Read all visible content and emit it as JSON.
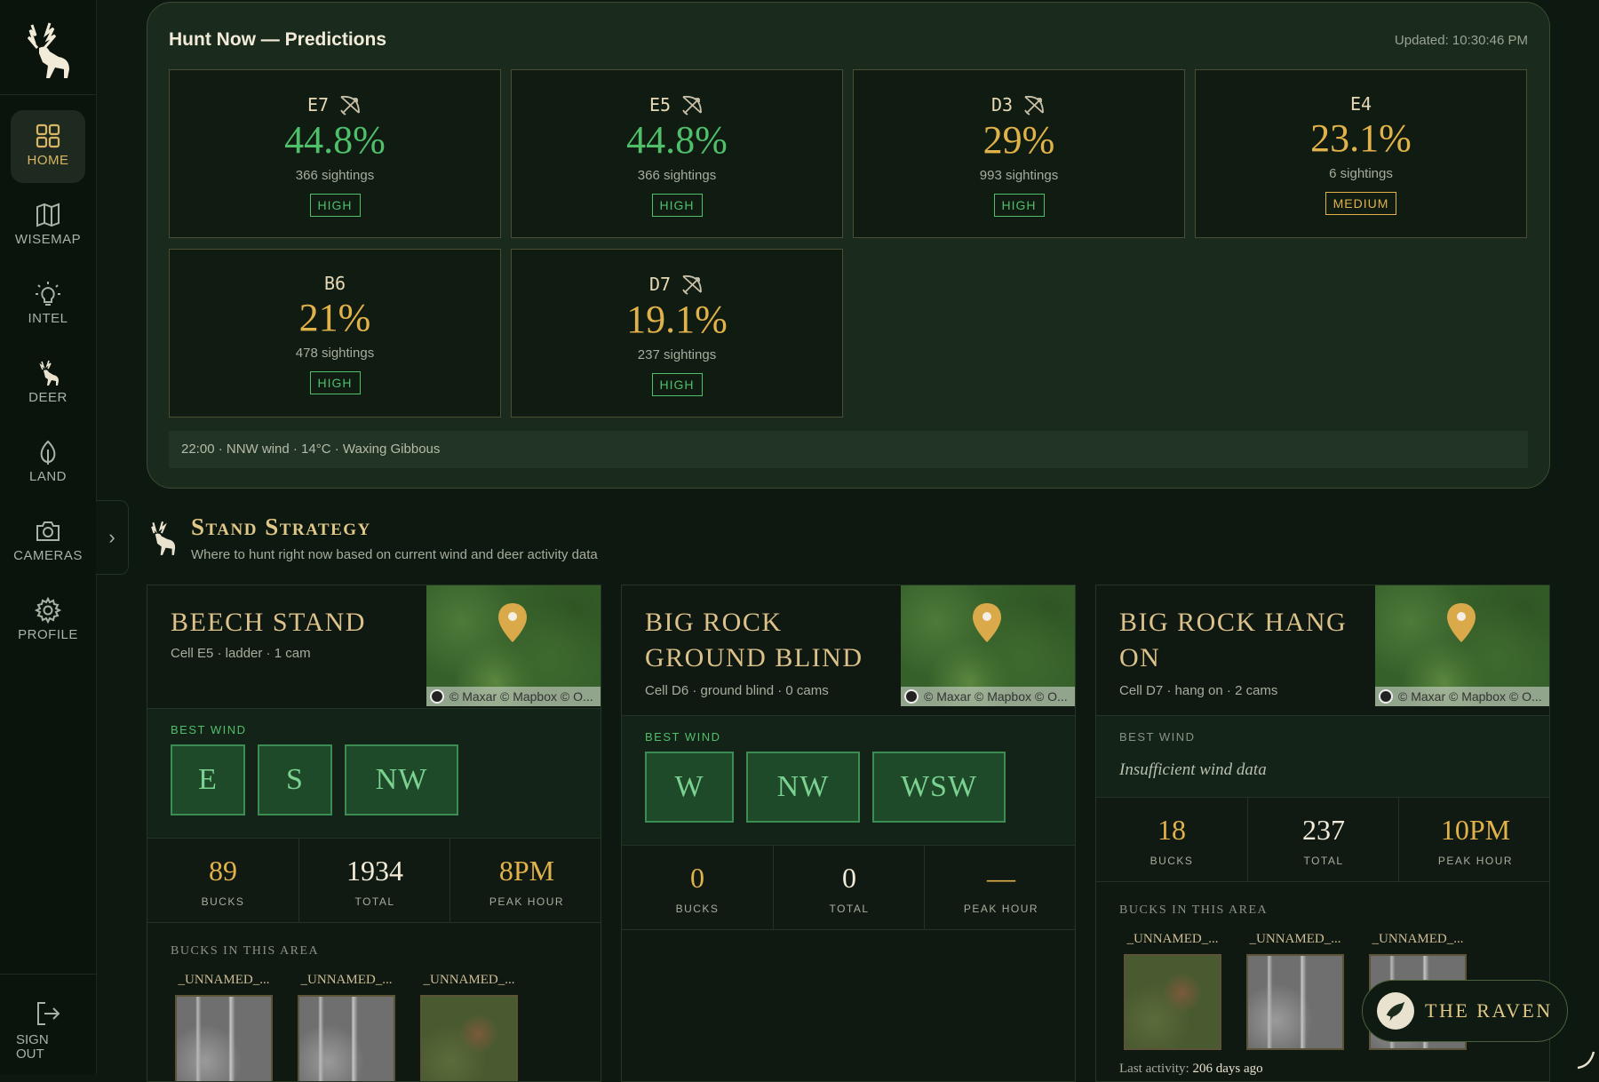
{
  "sidebar": {
    "items": [
      {
        "label": "HOME",
        "icon": "grid-icon",
        "active": true
      },
      {
        "label": "WISEMAP",
        "icon": "map-icon"
      },
      {
        "label": "INTEL",
        "icon": "lightbulb-icon"
      },
      {
        "label": "DEER",
        "icon": "deer-icon"
      },
      {
        "label": "LAND",
        "icon": "leaf-icon"
      },
      {
        "label": "CAMERAS",
        "icon": "camera-icon"
      },
      {
        "label": "PROFILE",
        "icon": "gear-icon"
      }
    ],
    "signout_label": "SIGN OUT"
  },
  "predictions": {
    "title": "Hunt Now — Predictions",
    "updated": "Updated: 10:30:46 PM",
    "cards": [
      {
        "cell": "E7",
        "pct": "44.8%",
        "sightings": "366 sightings",
        "level": "HIGH",
        "bow": true,
        "color": "green"
      },
      {
        "cell": "E5",
        "pct": "44.8%",
        "sightings": "366 sightings",
        "level": "HIGH",
        "bow": true,
        "color": "green"
      },
      {
        "cell": "D3",
        "pct": "29%",
        "sightings": "993 sightings",
        "level": "HIGH",
        "bow": true,
        "color": "gold"
      },
      {
        "cell": "E4",
        "pct": "23.1%",
        "sightings": "6 sightings",
        "level": "MEDIUM",
        "bow": false,
        "color": "gold"
      },
      {
        "cell": "B6",
        "pct": "21%",
        "sightings": "478 sightings",
        "level": "HIGH",
        "bow": false,
        "color": "gold"
      },
      {
        "cell": "D7",
        "pct": "19.1%",
        "sightings": "237 sightings",
        "level": "HIGH",
        "bow": true,
        "color": "gold"
      }
    ],
    "footer": "22:00 · NNW wind · 14°C · Waxing Gibbous"
  },
  "strategy": {
    "title": "Stand Strategy",
    "subtitle": "Where to hunt right now based on current wind and deer activity data",
    "map_attribution": "© Maxar © Mapbox © O...",
    "best_wind_label": "BEST WIND",
    "bucks_label": "BUCKS IN THIS AREA",
    "stats_labels": {
      "bucks": "BUCKS",
      "total": "TOTAL",
      "peak": "PEAK HOUR"
    },
    "stands": [
      {
        "name": "BEECH STAND",
        "meta": "Cell E5 · ladder · 1 cam",
        "winds": [
          "E",
          "S",
          "NW"
        ],
        "no_wind": "",
        "bucks": "89",
        "total": "1934",
        "peak": "8PM",
        "buck_names": [
          "_UNNAMED_...",
          "_UNNAMED_...",
          "_UNNAMED_..."
        ],
        "last": ""
      },
      {
        "name": "BIG ROCK GROUND BLIND",
        "meta": "Cell D6 · ground blind · 0 cams",
        "winds": [
          "W",
          "NW",
          "WSW"
        ],
        "no_wind": "",
        "bucks": "0",
        "total": "0",
        "peak": "—",
        "buck_names": [],
        "last": ""
      },
      {
        "name": "BIG ROCK HANG ON",
        "meta": "Cell D7 · hang on · 2 cams",
        "winds": [],
        "no_wind": "Insufficient wind data",
        "bucks": "18",
        "total": "237",
        "peak": "10PM",
        "buck_names": [
          "_UNNAMED_...",
          "_UNNAMED_...",
          "_UNNAMED_..."
        ],
        "last_prefix": "Last activity:",
        "last_value": "206 days ago"
      }
    ]
  },
  "raven_label": "THE RAVEN",
  "colors": {
    "accent_gold": "#e1b24a",
    "accent_green": "#4fbf6a",
    "background": "#0d1810"
  }
}
